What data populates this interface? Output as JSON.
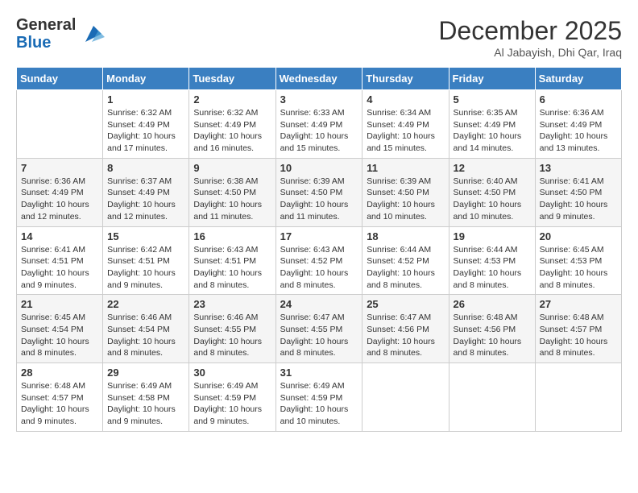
{
  "header": {
    "logo_line1": "General",
    "logo_line2": "Blue",
    "month": "December 2025",
    "location": "Al Jabayish, Dhi Qar, Iraq"
  },
  "days_of_week": [
    "Sunday",
    "Monday",
    "Tuesday",
    "Wednesday",
    "Thursday",
    "Friday",
    "Saturday"
  ],
  "weeks": [
    [
      {
        "day": "",
        "info": ""
      },
      {
        "day": "1",
        "info": "Sunrise: 6:32 AM\nSunset: 4:49 PM\nDaylight: 10 hours\nand 17 minutes."
      },
      {
        "day": "2",
        "info": "Sunrise: 6:32 AM\nSunset: 4:49 PM\nDaylight: 10 hours\nand 16 minutes."
      },
      {
        "day": "3",
        "info": "Sunrise: 6:33 AM\nSunset: 4:49 PM\nDaylight: 10 hours\nand 15 minutes."
      },
      {
        "day": "4",
        "info": "Sunrise: 6:34 AM\nSunset: 4:49 PM\nDaylight: 10 hours\nand 15 minutes."
      },
      {
        "day": "5",
        "info": "Sunrise: 6:35 AM\nSunset: 4:49 PM\nDaylight: 10 hours\nand 14 minutes."
      },
      {
        "day": "6",
        "info": "Sunrise: 6:36 AM\nSunset: 4:49 PM\nDaylight: 10 hours\nand 13 minutes."
      }
    ],
    [
      {
        "day": "7",
        "info": "Sunrise: 6:36 AM\nSunset: 4:49 PM\nDaylight: 10 hours\nand 12 minutes."
      },
      {
        "day": "8",
        "info": "Sunrise: 6:37 AM\nSunset: 4:49 PM\nDaylight: 10 hours\nand 12 minutes."
      },
      {
        "day": "9",
        "info": "Sunrise: 6:38 AM\nSunset: 4:50 PM\nDaylight: 10 hours\nand 11 minutes."
      },
      {
        "day": "10",
        "info": "Sunrise: 6:39 AM\nSunset: 4:50 PM\nDaylight: 10 hours\nand 11 minutes."
      },
      {
        "day": "11",
        "info": "Sunrise: 6:39 AM\nSunset: 4:50 PM\nDaylight: 10 hours\nand 10 minutes."
      },
      {
        "day": "12",
        "info": "Sunrise: 6:40 AM\nSunset: 4:50 PM\nDaylight: 10 hours\nand 10 minutes."
      },
      {
        "day": "13",
        "info": "Sunrise: 6:41 AM\nSunset: 4:50 PM\nDaylight: 10 hours\nand 9 minutes."
      }
    ],
    [
      {
        "day": "14",
        "info": "Sunrise: 6:41 AM\nSunset: 4:51 PM\nDaylight: 10 hours\nand 9 minutes."
      },
      {
        "day": "15",
        "info": "Sunrise: 6:42 AM\nSunset: 4:51 PM\nDaylight: 10 hours\nand 9 minutes."
      },
      {
        "day": "16",
        "info": "Sunrise: 6:43 AM\nSunset: 4:51 PM\nDaylight: 10 hours\nand 8 minutes."
      },
      {
        "day": "17",
        "info": "Sunrise: 6:43 AM\nSunset: 4:52 PM\nDaylight: 10 hours\nand 8 minutes."
      },
      {
        "day": "18",
        "info": "Sunrise: 6:44 AM\nSunset: 4:52 PM\nDaylight: 10 hours\nand 8 minutes."
      },
      {
        "day": "19",
        "info": "Sunrise: 6:44 AM\nSunset: 4:53 PM\nDaylight: 10 hours\nand 8 minutes."
      },
      {
        "day": "20",
        "info": "Sunrise: 6:45 AM\nSunset: 4:53 PM\nDaylight: 10 hours\nand 8 minutes."
      }
    ],
    [
      {
        "day": "21",
        "info": "Sunrise: 6:45 AM\nSunset: 4:54 PM\nDaylight: 10 hours\nand 8 minutes."
      },
      {
        "day": "22",
        "info": "Sunrise: 6:46 AM\nSunset: 4:54 PM\nDaylight: 10 hours\nand 8 minutes."
      },
      {
        "day": "23",
        "info": "Sunrise: 6:46 AM\nSunset: 4:55 PM\nDaylight: 10 hours\nand 8 minutes."
      },
      {
        "day": "24",
        "info": "Sunrise: 6:47 AM\nSunset: 4:55 PM\nDaylight: 10 hours\nand 8 minutes."
      },
      {
        "day": "25",
        "info": "Sunrise: 6:47 AM\nSunset: 4:56 PM\nDaylight: 10 hours\nand 8 minutes."
      },
      {
        "day": "26",
        "info": "Sunrise: 6:48 AM\nSunset: 4:56 PM\nDaylight: 10 hours\nand 8 minutes."
      },
      {
        "day": "27",
        "info": "Sunrise: 6:48 AM\nSunset: 4:57 PM\nDaylight: 10 hours\nand 8 minutes."
      }
    ],
    [
      {
        "day": "28",
        "info": "Sunrise: 6:48 AM\nSunset: 4:57 PM\nDaylight: 10 hours\nand 9 minutes."
      },
      {
        "day": "29",
        "info": "Sunrise: 6:49 AM\nSunset: 4:58 PM\nDaylight: 10 hours\nand 9 minutes."
      },
      {
        "day": "30",
        "info": "Sunrise: 6:49 AM\nSunset: 4:59 PM\nDaylight: 10 hours\nand 9 minutes."
      },
      {
        "day": "31",
        "info": "Sunrise: 6:49 AM\nSunset: 4:59 PM\nDaylight: 10 hours\nand 10 minutes."
      },
      {
        "day": "",
        "info": ""
      },
      {
        "day": "",
        "info": ""
      },
      {
        "day": "",
        "info": ""
      }
    ]
  ]
}
